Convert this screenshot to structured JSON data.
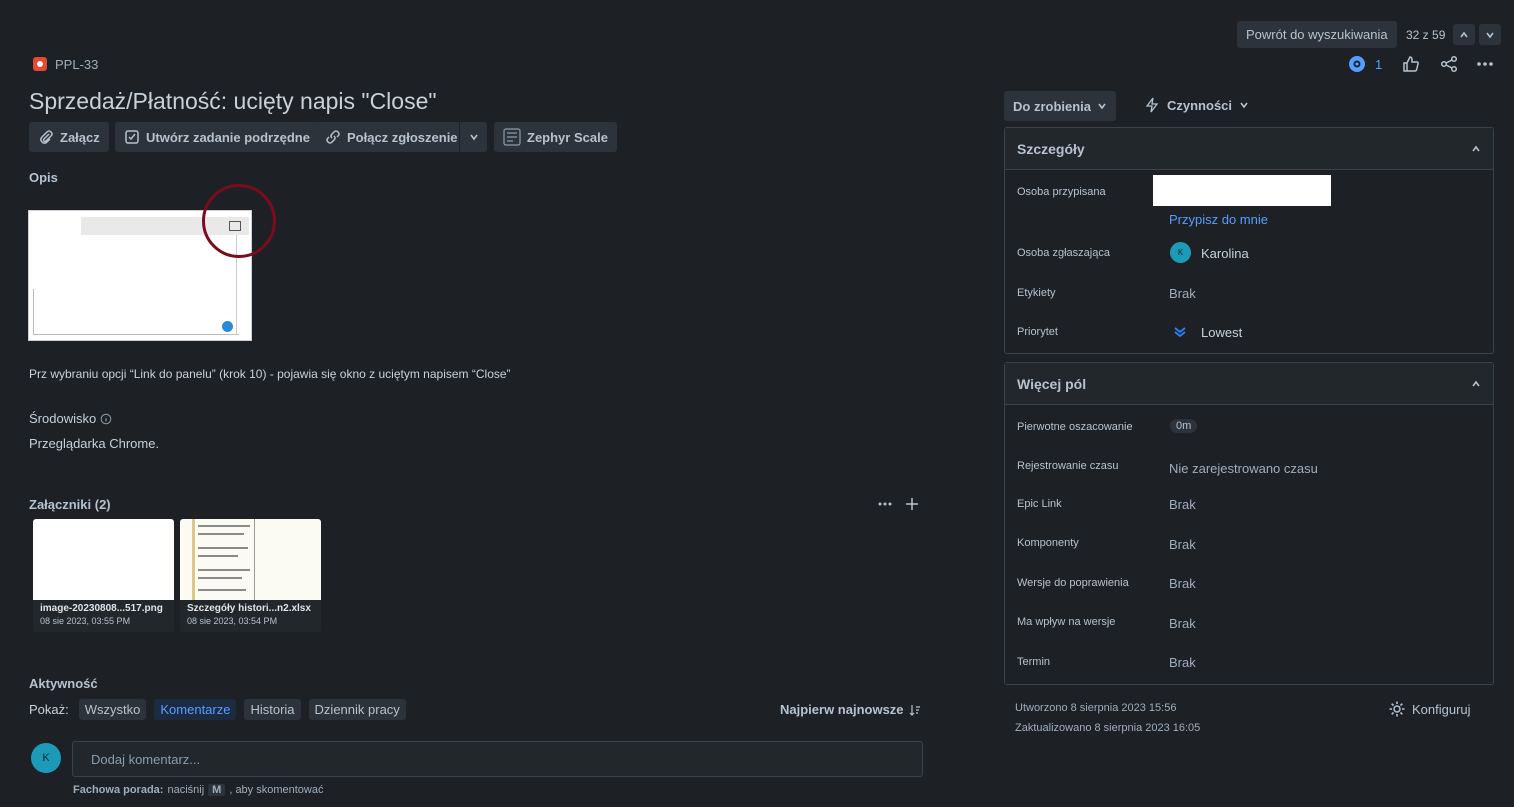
{
  "nav": {
    "back_label": "Powrót do wyszukiwania",
    "counter": "32 z 59",
    "watch_count": "1"
  },
  "issue": {
    "key": "PPL-33",
    "title": "Sprzedaż/Płatność: ucięty napis \"Close\""
  },
  "toolbar": {
    "attach": "Załącz",
    "create_subtask": "Utwórz zadanie podrzędne",
    "link_issue": "Połącz zgłoszenie",
    "zephyr": "Zephyr Scale"
  },
  "description": {
    "heading": "Opis",
    "text": "Prz wybraniu opcji “Link do panelu” (krok 10) - pojawia się okno z uciętym napisem “Close”"
  },
  "environment": {
    "heading": "Środowisko",
    "text": "Przeglądarka Chrome."
  },
  "attachments": {
    "heading": "Załączniki (2)",
    "items": [
      {
        "name": "image-20230808...517.png",
        "date": "08 sie 2023, 03:55 PM"
      },
      {
        "name": "Szczegóły histori...n2.xlsx",
        "date": "08 sie 2023, 03:54 PM"
      }
    ]
  },
  "activity": {
    "heading": "Aktywność",
    "show_label": "Pokaż:",
    "filters": [
      "Wszystko",
      "Komentarze",
      "Historia",
      "Dziennik pracy"
    ],
    "sort_label": "Najpierw najnowsze",
    "comment_placeholder": "Dodaj komentarz...",
    "avatar_letter": "K",
    "tip_prefix": "Fachowa porada:",
    "tip_middle": "naciśnij",
    "tip_key": "M",
    "tip_suffix": ", aby skomentować"
  },
  "status": {
    "label": "Do zrobienia",
    "actions_label": "Czynności"
  },
  "details": {
    "heading": "Szczegóły",
    "assignee_label": "Osoba przypisana",
    "assign_to_me": "Przypisz do mnie",
    "reporter_label": "Osoba zgłaszająca",
    "reporter_name": "Karolina",
    "reporter_initial": "K",
    "labels_label": "Etykiety",
    "labels_value": "Brak",
    "priority_label": "Priorytet",
    "priority_value": "Lowest"
  },
  "more_fields": {
    "heading": "Więcej pól",
    "rows": [
      {
        "label": "Pierwotne oszacowanie",
        "value": "0m"
      },
      {
        "label": "Rejestrowanie czasu",
        "value": "Nie zarejestrowano czasu"
      },
      {
        "label": "Epic Link",
        "value": "Brak"
      },
      {
        "label": "Komponenty",
        "value": "Brak"
      },
      {
        "label": "Wersje do poprawienia",
        "value": "Brak"
      },
      {
        "label": "Ma wpływ na wersje",
        "value": "Brak"
      },
      {
        "label": "Termin",
        "value": "Brak"
      }
    ]
  },
  "meta": {
    "created": "Utworzono 8 sierpnia 2023 15:56",
    "updated": "Zaktualizowano 8 sierpnia 2023 16:05",
    "configure": "Konfiguruj"
  },
  "colors": {
    "background": "#1d2125",
    "accent": "#579dff",
    "issue_type": "#e34935",
    "annotation_circle": "#7a0c1e"
  }
}
